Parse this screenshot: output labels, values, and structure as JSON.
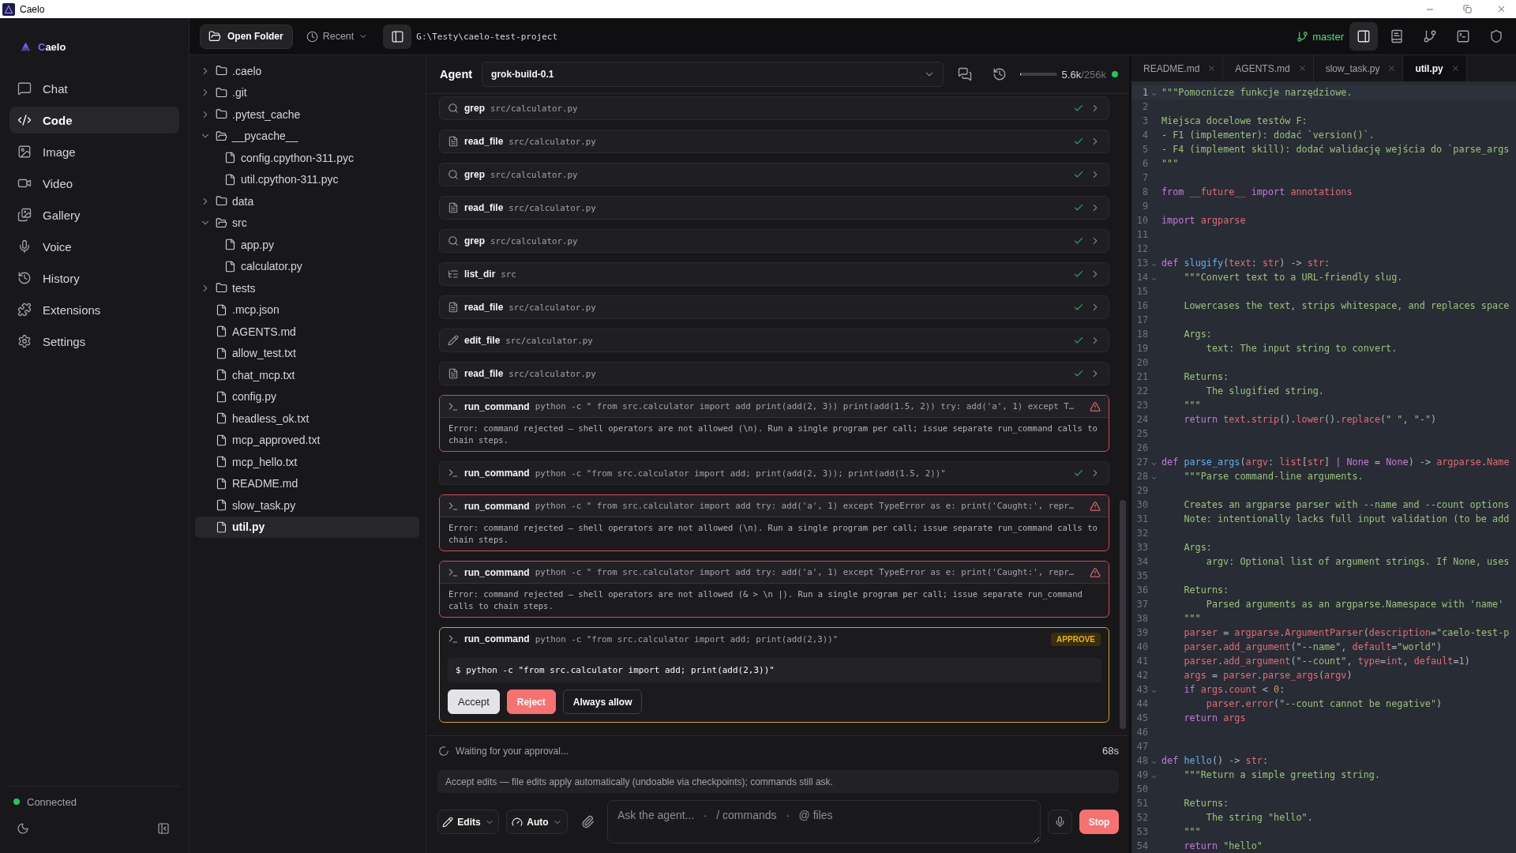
{
  "window": {
    "title": "Caelo"
  },
  "sidebar": {
    "brand": "Caelo",
    "nav": [
      {
        "label": "Chat",
        "kind": "chat",
        "selected": false
      },
      {
        "label": "Code",
        "kind": "code",
        "selected": true
      },
      {
        "label": "Image",
        "kind": "image",
        "selected": false
      },
      {
        "label": "Video",
        "kind": "video",
        "selected": false
      },
      {
        "label": "Gallery",
        "kind": "gallery",
        "selected": false
      },
      {
        "label": "Voice",
        "kind": "voice",
        "selected": false
      },
      {
        "label": "History",
        "kind": "history",
        "selected": false
      },
      {
        "label": "Extensions",
        "kind": "extensions",
        "selected": false
      },
      {
        "label": "Settings",
        "kind": "settings",
        "selected": false
      }
    ],
    "status": {
      "label": "Connected",
      "online": true
    }
  },
  "toolbar": {
    "open_folder": "Open Folder",
    "recent": "Recent",
    "files_panel": {
      "selected": true
    },
    "path": "G:\\Testy\\caelo-test-project",
    "branch": "master",
    "tools": [
      {
        "kind": "panel",
        "selected": true
      },
      {
        "kind": "notes",
        "selected": false
      },
      {
        "kind": "branch",
        "selected": false
      },
      {
        "kind": "terminal",
        "selected": false
      },
      {
        "kind": "shield",
        "selected": false
      }
    ]
  },
  "file_tree": [
    {
      "name": ".caelo",
      "kind": "folder",
      "expanded": false,
      "selected": false
    },
    {
      "name": ".git",
      "kind": "folder",
      "expanded": false,
      "selected": false
    },
    {
      "name": ".pytest_cache",
      "kind": "folder",
      "expanded": false,
      "selected": false
    },
    {
      "name": "__pycache__",
      "kind": "folder",
      "expanded": true,
      "selected": false,
      "children": [
        {
          "name": "config.cpython-311.pyc",
          "kind": "file",
          "selected": false
        },
        {
          "name": "util.cpython-311.pyc",
          "kind": "file",
          "selected": false
        }
      ]
    },
    {
      "name": "data",
      "kind": "folder",
      "expanded": false,
      "selected": false
    },
    {
      "name": "src",
      "kind": "folder",
      "expanded": true,
      "selected": false,
      "children": [
        {
          "name": "app.py",
          "kind": "file",
          "selected": false
        },
        {
          "name": "calculator.py",
          "kind": "file",
          "selected": false
        }
      ]
    },
    {
      "name": "tests",
      "kind": "folder",
      "expanded": false,
      "selected": false
    },
    {
      "name": ".mcp.json",
      "kind": "file",
      "selected": false
    },
    {
      "name": "AGENTS.md",
      "kind": "file",
      "selected": false
    },
    {
      "name": "allow_test.txt",
      "kind": "file",
      "selected": false
    },
    {
      "name": "chat_mcp.txt",
      "kind": "file",
      "selected": false
    },
    {
      "name": "config.py",
      "kind": "file",
      "selected": false
    },
    {
      "name": "headless_ok.txt",
      "kind": "file",
      "selected": false
    },
    {
      "name": "mcp_approved.txt",
      "kind": "file",
      "selected": false
    },
    {
      "name": "mcp_hello.txt",
      "kind": "file",
      "selected": false
    },
    {
      "name": "README.md",
      "kind": "file",
      "selected": false
    },
    {
      "name": "slow_task.py",
      "kind": "file",
      "selected": false
    },
    {
      "name": "util.py",
      "kind": "file",
      "selected": true
    }
  ],
  "agent": {
    "title": "Agent",
    "model": "grok-build-0.1",
    "context": {
      "level": 0.022,
      "used": "5.6k",
      "total": "/256k",
      "online": true
    },
    "tool_calls": [
      {
        "kind": "search",
        "tool": "grep",
        "argument": "src/calculator.py",
        "ok": true,
        "failed": false,
        "awaiting_approval": false
      },
      {
        "kind": "read",
        "tool": "read_file",
        "argument": "src/calculator.py",
        "ok": true,
        "failed": false,
        "awaiting_approval": false
      },
      {
        "kind": "search",
        "tool": "grep",
        "argument": "src/calculator.py",
        "ok": true,
        "failed": false,
        "awaiting_approval": false
      },
      {
        "kind": "read",
        "tool": "read_file",
        "argument": "src/calculator.py",
        "ok": true,
        "failed": false,
        "awaiting_approval": false
      },
      {
        "kind": "search",
        "tool": "grep",
        "argument": "src/calculator.py",
        "ok": true,
        "failed": false,
        "awaiting_approval": false
      },
      {
        "kind": "list",
        "tool": "list_dir",
        "argument": "src",
        "ok": true,
        "failed": false,
        "awaiting_approval": false
      },
      {
        "kind": "read",
        "tool": "read_file",
        "argument": "src/calculator.py",
        "ok": true,
        "failed": false,
        "awaiting_approval": false
      },
      {
        "kind": "edit",
        "tool": "edit_file",
        "argument": "src/calculator.py",
        "ok": true,
        "failed": false,
        "awaiting_approval": false
      },
      {
        "kind": "read",
        "tool": "read_file",
        "argument": "src/calculator.py",
        "ok": true,
        "failed": false,
        "awaiting_approval": false
      },
      {
        "kind": "command",
        "tool": "run_command",
        "argument": "python -c \" from src.calculator import add print(add(2, 3)) print(add(1.5, 2)) try: add('a', 1) except T…",
        "ok": false,
        "failed": true,
        "awaiting_approval": false,
        "error": "Error: command rejected — shell operators are not allowed (\\n). Run a single program per call; issue separate run_command calls to chain steps."
      },
      {
        "kind": "command",
        "tool": "run_command",
        "argument": "python -c \"from src.calculator import add; print(add(2, 3)); print(add(1.5, 2))\"",
        "ok": true,
        "failed": false,
        "awaiting_approval": false
      },
      {
        "kind": "command",
        "tool": "run_command",
        "argument": "python -c \" from src.calculator import add try: add('a', 1) except TypeError as e: print('Caught:', repr…",
        "ok": false,
        "failed": true,
        "awaiting_approval": false,
        "error": "Error: command rejected — shell operators are not allowed (\\n). Run a single program per call; issue separate run_command calls to chain steps."
      },
      {
        "kind": "command",
        "tool": "run_command",
        "argument": "python -c \" from src.calculator import add try: add('a', 1) except TypeError as e: print('Caught:', repr…",
        "ok": false,
        "failed": true,
        "awaiting_approval": false,
        "error": "Error: command rejected — shell operators are not allowed (& > \\n |). Run a single program per call; issue separate run_command calls to chain steps."
      },
      {
        "kind": "command",
        "tool": "run_command",
        "argument": "python -c \"from src.calculator import add; print(add(2,3))\"",
        "ok": false,
        "failed": false,
        "awaiting_approval": true,
        "badge": "APPROVE",
        "command": "$ python -c \"from src.calculator import add; print(add(2,3))\"",
        "actions": [
          {
            "label": "Accept",
            "kind": "accept"
          },
          {
            "label": "Reject",
            "kind": "reject"
          },
          {
            "label": "Always allow",
            "kind": "always-allow"
          }
        ]
      }
    ],
    "status": {
      "message": "Waiting for your approval...",
      "elapsed": "68s"
    },
    "mode_hint": "Accept edits — file edits apply automatically (undoable via checkpoints); commands still ask.",
    "composer": {
      "edit_mode": "Edits",
      "autonomy": "Auto",
      "placeholder": "Ask the agent...   ·   / commands   ·   @ files",
      "stop": "Stop"
    }
  },
  "editor": {
    "tabs": [
      {
        "label": "README.md",
        "selected": false
      },
      {
        "label": "AGENTS.md",
        "selected": false
      },
      {
        "label": "slow_task.py",
        "selected": false
      },
      {
        "label": "util.py",
        "selected": true
      }
    ],
    "lines": [
      {
        "number": "1",
        "fold": true,
        "active": true,
        "tokens": [
          {
            "kind": "string",
            "text": "\"\"\"Pomocnicze funkcje narzędziowe."
          }
        ]
      },
      {
        "number": "2",
        "fold": false,
        "active": false
      },
      {
        "number": "3",
        "fold": false,
        "active": false,
        "tokens": [
          {
            "kind": "string",
            "text": "Miejsca docelowe testów F:"
          }
        ]
      },
      {
        "number": "4",
        "fold": false,
        "active": false,
        "tokens": [
          {
            "kind": "string",
            "text": "- F1 (implementer): dodać `version()`."
          }
        ]
      },
      {
        "number": "5",
        "fold": false,
        "active": false,
        "tokens": [
          {
            "kind": "string",
            "text": "- F4 (implement skill): dodać walidację wejścia do `parse_args"
          }
        ]
      },
      {
        "number": "6",
        "fold": false,
        "active": false,
        "tokens": [
          {
            "kind": "string",
            "text": "\"\"\""
          }
        ]
      },
      {
        "number": "7",
        "fold": false,
        "active": false
      },
      {
        "number": "8",
        "fold": false,
        "active": false,
        "tokens": [
          {
            "kind": "keyword",
            "text": "from "
          },
          {
            "kind": "name",
            "text": "__future__"
          },
          {
            "kind": "keyword",
            "text": " import "
          },
          {
            "kind": "name",
            "text": "annotations"
          }
        ]
      },
      {
        "number": "9",
        "fold": false,
        "active": false
      },
      {
        "number": "10",
        "fold": false,
        "active": false,
        "tokens": [
          {
            "kind": "keyword",
            "text": "import "
          },
          {
            "kind": "name",
            "text": "argparse"
          }
        ]
      },
      {
        "number": "11",
        "fold": false,
        "active": false
      },
      {
        "number": "12",
        "fold": false,
        "active": false
      },
      {
        "number": "13",
        "fold": true,
        "active": false,
        "tokens": [
          {
            "kind": "keyword",
            "text": "def "
          },
          {
            "kind": "function",
            "text": "slugify"
          },
          {
            "kind": "punct",
            "text": "("
          },
          {
            "kind": "name",
            "text": "text"
          },
          {
            "kind": "punct",
            "text": ": "
          },
          {
            "kind": "name",
            "text": "str"
          },
          {
            "kind": "punct",
            "text": ") -> "
          },
          {
            "kind": "name",
            "text": "str"
          },
          {
            "kind": "punct",
            "text": ":"
          }
        ]
      },
      {
        "number": "14",
        "fold": true,
        "active": false,
        "tokens": [
          {
            "kind": "string",
            "text": "    \"\"\"Convert text to a URL-friendly slug."
          }
        ]
      },
      {
        "number": "15",
        "fold": false,
        "active": false
      },
      {
        "number": "16",
        "fold": false,
        "active": false,
        "tokens": [
          {
            "kind": "string",
            "text": "    Lowercases the text, strips whitespace, and replaces space"
          }
        ]
      },
      {
        "number": "17",
        "fold": false,
        "active": false
      },
      {
        "number": "18",
        "fold": false,
        "active": false,
        "tokens": [
          {
            "kind": "string",
            "text": "    Args:"
          }
        ]
      },
      {
        "number": "19",
        "fold": false,
        "active": false,
        "tokens": [
          {
            "kind": "string",
            "text": "        text: The input string to convert."
          }
        ]
      },
      {
        "number": "20",
        "fold": false,
        "active": false
      },
      {
        "number": "21",
        "fold": false,
        "active": false,
        "tokens": [
          {
            "kind": "string",
            "text": "    Returns:"
          }
        ]
      },
      {
        "number": "22",
        "fold": false,
        "active": false,
        "tokens": [
          {
            "kind": "string",
            "text": "        The slugified string."
          }
        ]
      },
      {
        "number": "23",
        "fold": false,
        "active": false,
        "tokens": [
          {
            "kind": "string",
            "text": "    \"\"\""
          }
        ]
      },
      {
        "number": "24",
        "fold": false,
        "active": false,
        "tokens": [
          {
            "kind": "keyword",
            "text": "    return "
          },
          {
            "kind": "name",
            "text": "text"
          },
          {
            "kind": "punct",
            "text": "."
          },
          {
            "kind": "name",
            "text": "strip"
          },
          {
            "kind": "punct",
            "text": "()."
          },
          {
            "kind": "name",
            "text": "lower"
          },
          {
            "kind": "punct",
            "text": "()."
          },
          {
            "kind": "name",
            "text": "replace"
          },
          {
            "kind": "punct",
            "text": "("
          },
          {
            "kind": "string",
            "text": "\" \""
          },
          {
            "kind": "punct",
            "text": ", "
          },
          {
            "kind": "string",
            "text": "\"-\""
          },
          {
            "kind": "punct",
            "text": ")"
          }
        ]
      },
      {
        "number": "25",
        "fold": false,
        "active": false
      },
      {
        "number": "26",
        "fold": false,
        "active": false
      },
      {
        "number": "27",
        "fold": true,
        "active": false,
        "tokens": [
          {
            "kind": "keyword",
            "text": "def "
          },
          {
            "kind": "function",
            "text": "parse_args"
          },
          {
            "kind": "punct",
            "text": "("
          },
          {
            "kind": "name",
            "text": "argv"
          },
          {
            "kind": "punct",
            "text": ": "
          },
          {
            "kind": "name",
            "text": "list"
          },
          {
            "kind": "punct",
            "text": "["
          },
          {
            "kind": "name",
            "text": "str"
          },
          {
            "kind": "punct",
            "text": "] "
          },
          {
            "kind": "keyword",
            "text": "| None"
          },
          {
            "kind": "punct",
            "text": " = "
          },
          {
            "kind": "keyword",
            "text": "None"
          },
          {
            "kind": "punct",
            "text": ") -> "
          },
          {
            "kind": "name",
            "text": "argparse"
          },
          {
            "kind": "punct",
            "text": "."
          },
          {
            "kind": "name",
            "text": "Name"
          }
        ]
      },
      {
        "number": "28",
        "fold": true,
        "active": false,
        "tokens": [
          {
            "kind": "string",
            "text": "    \"\"\"Parse command-line arguments."
          }
        ]
      },
      {
        "number": "29",
        "fold": false,
        "active": false
      },
      {
        "number": "30",
        "fold": false,
        "active": false,
        "tokens": [
          {
            "kind": "string",
            "text": "    Creates an argparse parser with --name and --count options"
          }
        ]
      },
      {
        "number": "31",
        "fold": false,
        "active": false,
        "tokens": [
          {
            "kind": "string",
            "text": "    Note: intentionally lacks full input validation (to be add"
          }
        ]
      },
      {
        "number": "32",
        "fold": false,
        "active": false
      },
      {
        "number": "33",
        "fold": false,
        "active": false,
        "tokens": [
          {
            "kind": "string",
            "text": "    Args:"
          }
        ]
      },
      {
        "number": "34",
        "fold": false,
        "active": false,
        "tokens": [
          {
            "kind": "string",
            "text": "        argv: Optional list of argument strings. If None, uses"
          }
        ]
      },
      {
        "number": "35",
        "fold": false,
        "active": false
      },
      {
        "number": "36",
        "fold": false,
        "active": false,
        "tokens": [
          {
            "kind": "string",
            "text": "    Returns:"
          }
        ]
      },
      {
        "number": "37",
        "fold": false,
        "active": false,
        "tokens": [
          {
            "kind": "string",
            "text": "        Parsed arguments as an argparse.Namespace with 'name'"
          }
        ]
      },
      {
        "number": "38",
        "fold": false,
        "active": false,
        "tokens": [
          {
            "kind": "string",
            "text": "    \"\"\""
          }
        ]
      },
      {
        "number": "39",
        "fold": false,
        "active": false,
        "tokens": [
          {
            "kind": "name",
            "text": "    parser"
          },
          {
            "kind": "punct",
            "text": " = "
          },
          {
            "kind": "name",
            "text": "argparse"
          },
          {
            "kind": "punct",
            "text": "."
          },
          {
            "kind": "name",
            "text": "ArgumentParser"
          },
          {
            "kind": "punct",
            "text": "("
          },
          {
            "kind": "name",
            "text": "description"
          },
          {
            "kind": "punct",
            "text": "="
          },
          {
            "kind": "string",
            "text": "\"caelo-test-p"
          }
        ]
      },
      {
        "number": "40",
        "fold": false,
        "active": false,
        "tokens": [
          {
            "kind": "name",
            "text": "    parser"
          },
          {
            "kind": "punct",
            "text": "."
          },
          {
            "kind": "name",
            "text": "add_argument"
          },
          {
            "kind": "punct",
            "text": "("
          },
          {
            "kind": "string",
            "text": "\"--name\""
          },
          {
            "kind": "punct",
            "text": ", "
          },
          {
            "kind": "name",
            "text": "default"
          },
          {
            "kind": "punct",
            "text": "="
          },
          {
            "kind": "string",
            "text": "\"world\""
          },
          {
            "kind": "punct",
            "text": ")"
          }
        ]
      },
      {
        "number": "41",
        "fold": false,
        "active": false,
        "tokens": [
          {
            "kind": "name",
            "text": "    parser"
          },
          {
            "kind": "punct",
            "text": "."
          },
          {
            "kind": "name",
            "text": "add_argument"
          },
          {
            "kind": "punct",
            "text": "("
          },
          {
            "kind": "string",
            "text": "\"--count\""
          },
          {
            "kind": "punct",
            "text": ", "
          },
          {
            "kind": "name",
            "text": "type"
          },
          {
            "kind": "punct",
            "text": "="
          },
          {
            "kind": "name",
            "text": "int"
          },
          {
            "kind": "punct",
            "text": ", "
          },
          {
            "kind": "name",
            "text": "default"
          },
          {
            "kind": "punct",
            "text": "="
          },
          {
            "kind": "number",
            "text": "1"
          },
          {
            "kind": "punct",
            "text": ")"
          }
        ]
      },
      {
        "number": "42",
        "fold": false,
        "active": false,
        "tokens": [
          {
            "kind": "name",
            "text": "    args"
          },
          {
            "kind": "punct",
            "text": " = "
          },
          {
            "kind": "name",
            "text": "parser"
          },
          {
            "kind": "punct",
            "text": "."
          },
          {
            "kind": "name",
            "text": "parse_args"
          },
          {
            "kind": "punct",
            "text": "("
          },
          {
            "kind": "name",
            "text": "argv"
          },
          {
            "kind": "punct",
            "text": ")"
          }
        ]
      },
      {
        "number": "43",
        "fold": true,
        "active": false,
        "tokens": [
          {
            "kind": "keyword",
            "text": "    if "
          },
          {
            "kind": "name",
            "text": "args"
          },
          {
            "kind": "punct",
            "text": "."
          },
          {
            "kind": "name",
            "text": "count"
          },
          {
            "kind": "punct",
            "text": " < "
          },
          {
            "kind": "number",
            "text": "0"
          },
          {
            "kind": "punct",
            "text": ":"
          }
        ]
      },
      {
        "number": "44",
        "fold": false,
        "active": false,
        "tokens": [
          {
            "kind": "name",
            "text": "        parser"
          },
          {
            "kind": "punct",
            "text": "."
          },
          {
            "kind": "name",
            "text": "error"
          },
          {
            "kind": "punct",
            "text": "("
          },
          {
            "kind": "string",
            "text": "\"--count cannot be negative\""
          },
          {
            "kind": "punct",
            "text": ")"
          }
        ]
      },
      {
        "number": "45",
        "fold": false,
        "active": false,
        "tokens": [
          {
            "kind": "keyword",
            "text": "    return "
          },
          {
            "kind": "name",
            "text": "args"
          }
        ]
      },
      {
        "number": "46",
        "fold": false,
        "active": false
      },
      {
        "number": "47",
        "fold": false,
        "active": false
      },
      {
        "number": "48",
        "fold": true,
        "active": false,
        "tokens": [
          {
            "kind": "keyword",
            "text": "def "
          },
          {
            "kind": "function",
            "text": "hello"
          },
          {
            "kind": "punct",
            "text": "() -> "
          },
          {
            "kind": "name",
            "text": "str"
          },
          {
            "kind": "punct",
            "text": ":"
          }
        ]
      },
      {
        "number": "49",
        "fold": true,
        "active": false,
        "tokens": [
          {
            "kind": "string",
            "text": "    \"\"\"Return a simple greeting string."
          }
        ]
      },
      {
        "number": "50",
        "fold": false,
        "active": false
      },
      {
        "number": "51",
        "fold": false,
        "active": false,
        "tokens": [
          {
            "kind": "string",
            "text": "    Returns:"
          }
        ]
      },
      {
        "number": "52",
        "fold": false,
        "active": false,
        "tokens": [
          {
            "kind": "string",
            "text": "        The string \"hello\"."
          }
        ]
      },
      {
        "number": "53",
        "fold": false,
        "active": false,
        "tokens": [
          {
            "kind": "string",
            "text": "    \"\"\""
          }
        ]
      },
      {
        "number": "54",
        "fold": false,
        "active": false,
        "tokens": [
          {
            "kind": "keyword",
            "text": "    return "
          },
          {
            "kind": "string",
            "text": "\"hello\""
          }
        ]
      }
    ]
  }
}
